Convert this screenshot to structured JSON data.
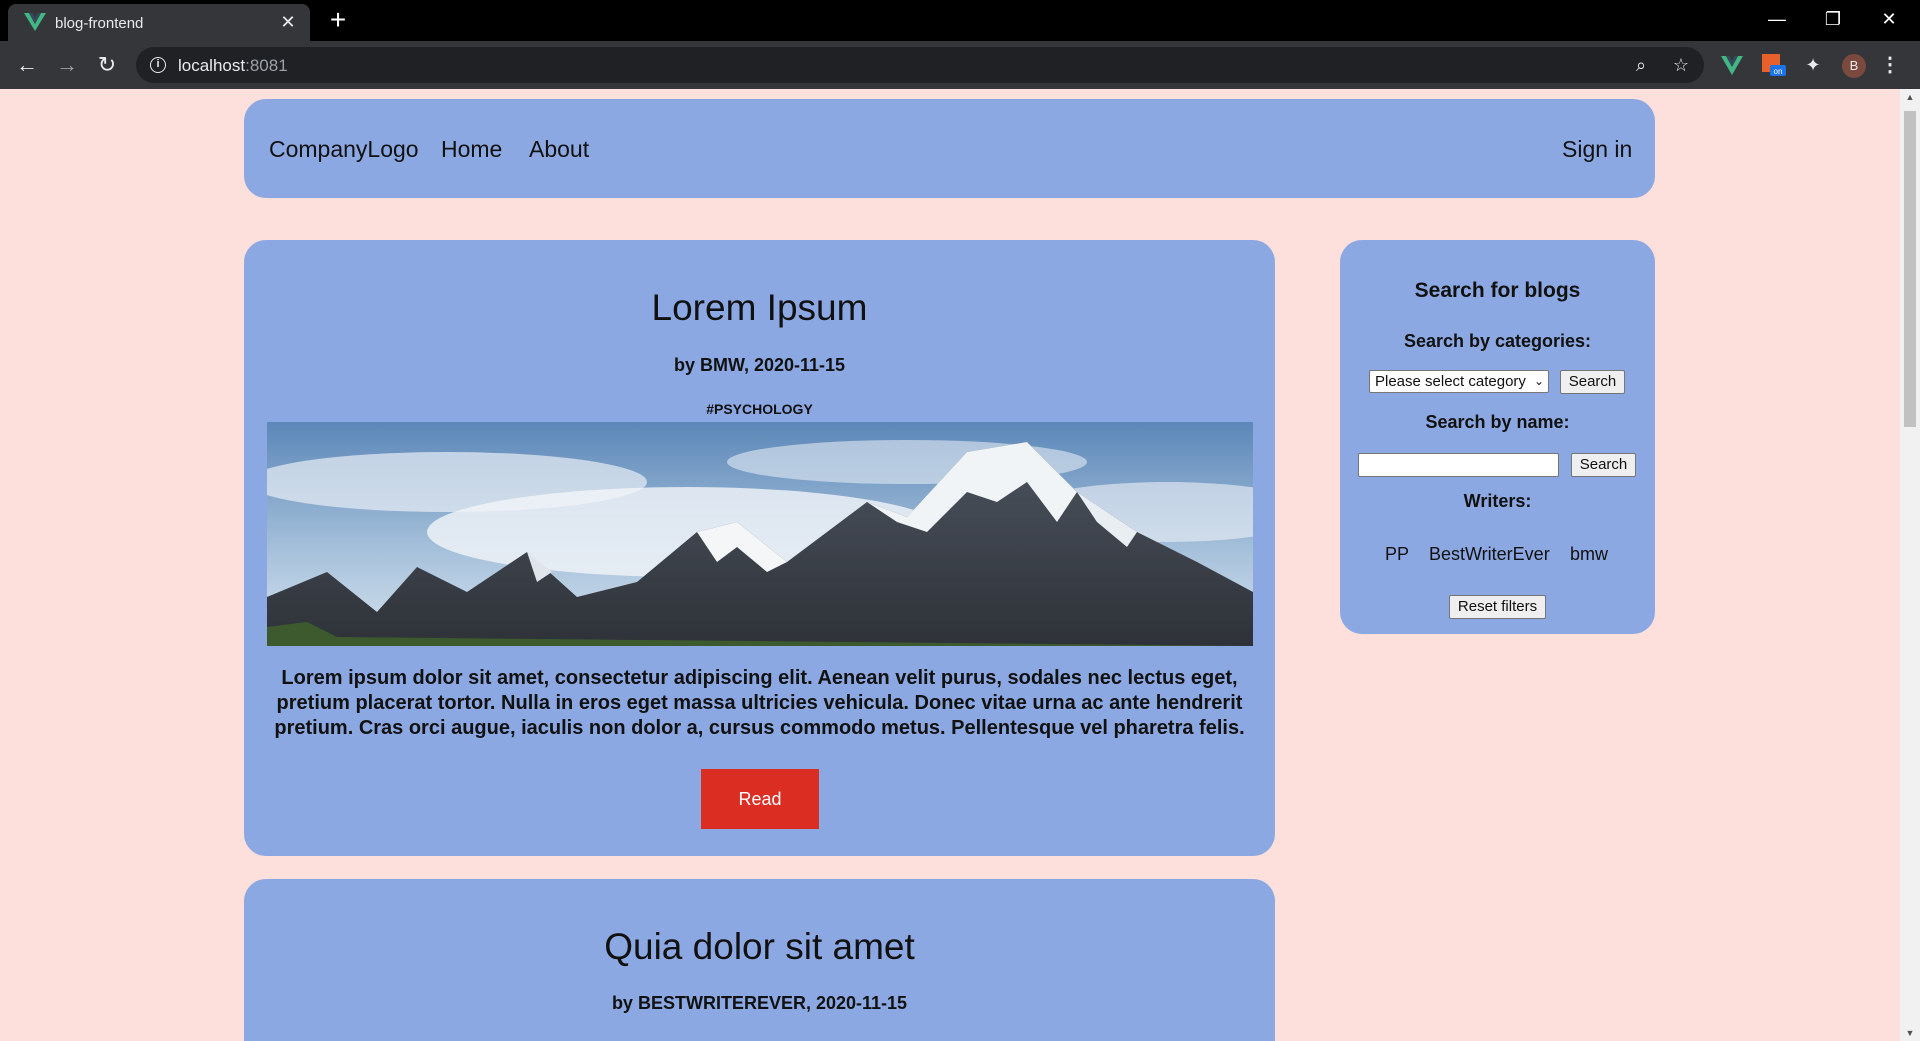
{
  "browser": {
    "tab_title": "blog-frontend",
    "url_host": "localhost",
    "url_port": ":8081",
    "profile_initial": "B"
  },
  "navbar": {
    "logo": "CompanyLogo",
    "links": [
      "Home",
      "About"
    ],
    "sign_in": "Sign in"
  },
  "posts": [
    {
      "title": "Lorem Ipsum",
      "meta": "by BMW, 2020-11-15",
      "tag": "#PSYCHOLOGY",
      "body": "Lorem ipsum dolor sit amet, consectetur adipiscing elit. Aenean velit purus, sodales nec lectus eget, pretium placerat tortor. Nulla in eros eget massa ultricies vehicula. Donec vitae urna ac ante hendrerit pretium. Cras orci augue, iaculis non dolor a, cursus commodo metus. Pellentesque vel pharetra felis.",
      "button": "Read"
    },
    {
      "title": "Quia dolor sit amet",
      "meta": "by BESTWRITEREVER, 2020-11-15"
    }
  ],
  "sidebar": {
    "heading": "Search for blogs",
    "category_label": "Search by categories:",
    "category_select": "Please select category",
    "search_button": "Search",
    "name_label": "Search by name:",
    "name_placeholder": "",
    "writers_label": "Writers:",
    "writers": [
      "PP",
      "BestWriterEver",
      "bmw"
    ],
    "reset_button": "Reset filters"
  },
  "colors": {
    "page_background": "#fde0dc",
    "card_background": "#8ca8e2",
    "read_button": "#dc2d23"
  }
}
